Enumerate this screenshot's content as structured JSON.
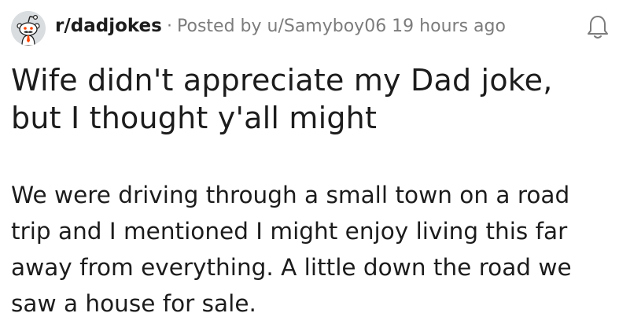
{
  "post": {
    "subreddit": "r/dadjokes",
    "meta_separator": "·",
    "posted_by": "Posted by u/Samyboy06 19 hours ago",
    "title": "Wife didn't appreciate my Dad joke, but I thought y'all might",
    "body": "We were driving through a small town on a road trip and I mentioned I might enjoy living this far away from everything. A little down the road we saw a house for sale."
  },
  "icons": {
    "avatar": "snoo-avatar-icon",
    "notify": "bell-icon"
  },
  "colors": {
    "text": "#1c1c1c",
    "meta": "#7c7c7c",
    "avatar_bg": "#d9dde0"
  }
}
